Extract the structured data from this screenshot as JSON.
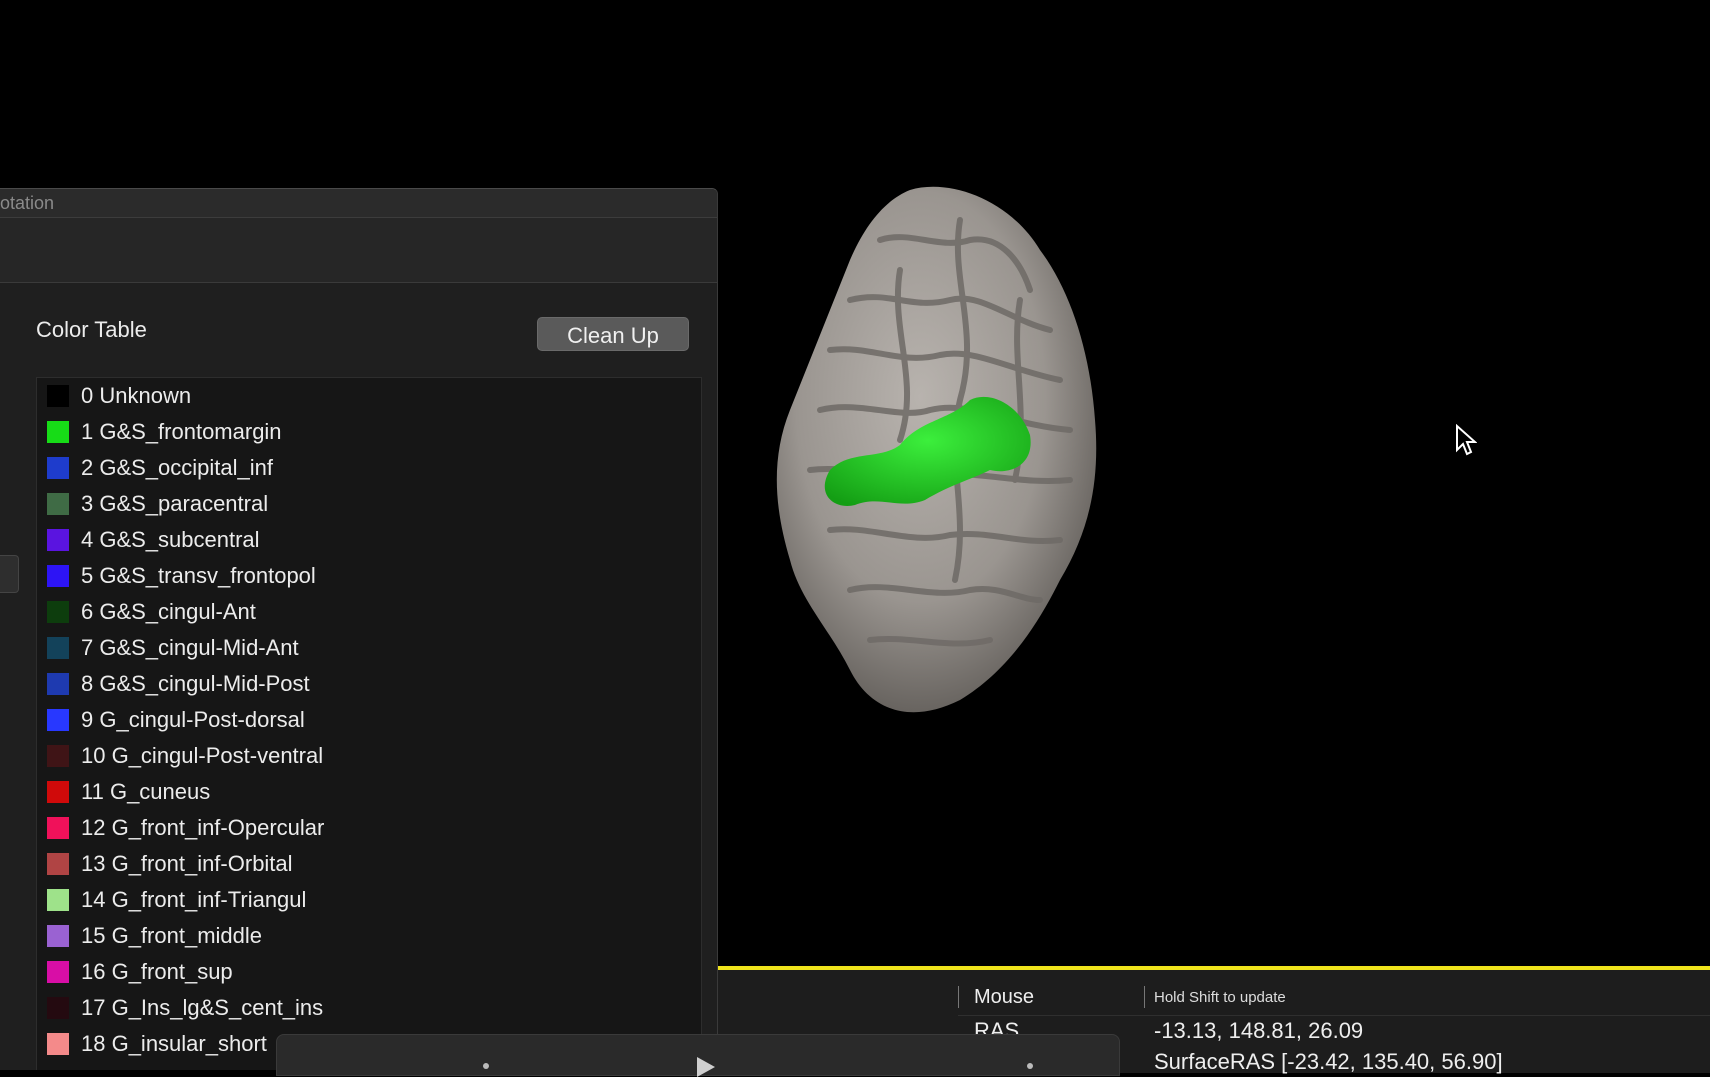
{
  "panel": {
    "title": "otation",
    "color_table_label": "Color Table",
    "cleanup_label": "Clean Up"
  },
  "color_table": [
    {
      "label": "0 Unknown",
      "color": "#000000"
    },
    {
      "label": "1 G&S_frontomargin",
      "color": "#17dc17"
    },
    {
      "label": "2 G&S_occipital_inf",
      "color": "#1e3ccc"
    },
    {
      "label": "3 G&S_paracentral",
      "color": "#3f6b45"
    },
    {
      "label": "4 G&S_subcentral",
      "color": "#5a14e0"
    },
    {
      "label": "5 G&S_transv_frontopol",
      "color": "#2d14f5"
    },
    {
      "label": "6 G&S_cingul-Ant",
      "color": "#0d3d0d"
    },
    {
      "label": "7 G&S_cingul-Mid-Ant",
      "color": "#13425a"
    },
    {
      "label": "8 G&S_cingul-Mid-Post",
      "color": "#1e3ab0"
    },
    {
      "label": "9 G_cingul-Post-dorsal",
      "color": "#2838ff"
    },
    {
      "label": "10 G_cingul-Post-ventral",
      "color": "#3f1416"
    },
    {
      "label": "11 G_cuneus",
      "color": "#d00a0a"
    },
    {
      "label": "12 G_front_inf-Opercular",
      "color": "#f0115a"
    },
    {
      "label": "13 G_front_inf-Orbital",
      "color": "#b04444"
    },
    {
      "label": "14 G_front_inf-Triangul",
      "color": "#9ee28a"
    },
    {
      "label": "15 G_front_middle",
      "color": "#9a62d2"
    },
    {
      "label": "16 G_front_sup",
      "color": "#d80ea6"
    },
    {
      "label": "17 G_Ins_lg&S_cent_ins",
      "color": "#240a10"
    },
    {
      "label": "18 G_insular_short",
      "color": "#f48a8a"
    }
  ],
  "info": {
    "mouse_label": "Mouse",
    "hint": "Hold Shift to update",
    "ras_label": "RAS",
    "ras_value": "-13.13, 148.81, 26.09",
    "surface_ras": "SurfaceRAS  [-23.42, 135.40, 56.90]"
  },
  "colors": {
    "background": "#000000",
    "panel": "#1f1f1f",
    "highlight": "#f0e41c",
    "label_green": "#22d822"
  }
}
